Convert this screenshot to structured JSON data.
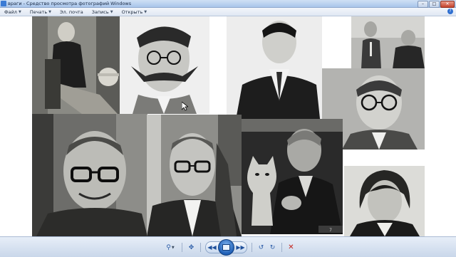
{
  "window": {
    "title": "враги - Средство просмотра фотографий Windows",
    "buttons": {
      "minimize": "–",
      "maximize": "□",
      "close": "✕"
    }
  },
  "menu": {
    "items": [
      {
        "label": "Файл",
        "has_dropdown": true
      },
      {
        "label": "Печать",
        "has_dropdown": true
      },
      {
        "label": "Эл. почта",
        "has_dropdown": false
      },
      {
        "label": "Запись",
        "has_dropdown": true
      },
      {
        "label": "Открыть",
        "has_dropdown": true
      }
    ],
    "help_glyph": "?"
  },
  "photos": [
    {
      "name": "photo-seated-man-top-hat"
    },
    {
      "name": "photo-man-mustache-glasses"
    },
    {
      "name": "photo-man-dark-suit"
    },
    {
      "name": "photo-two-men-small"
    },
    {
      "name": "photo-man-round-glasses"
    },
    {
      "name": "photo-bald-man-smiling-glasses"
    },
    {
      "name": "photo-man-glasses-white-shirt"
    },
    {
      "name": "photo-man-with-cat",
      "caption": "7"
    },
    {
      "name": "photo-young-man-long-hair"
    }
  ],
  "controls": {
    "zoom": "⚲",
    "actual_size": "✥",
    "previous": "◀◀",
    "next": "▶▶",
    "rotate_ccw": "↺",
    "rotate_cw": "↻",
    "delete": "✕"
  },
  "colors": {
    "titlebar": "#a9c5ea",
    "accent": "#1f5fb6",
    "delete": "#c4221a"
  }
}
